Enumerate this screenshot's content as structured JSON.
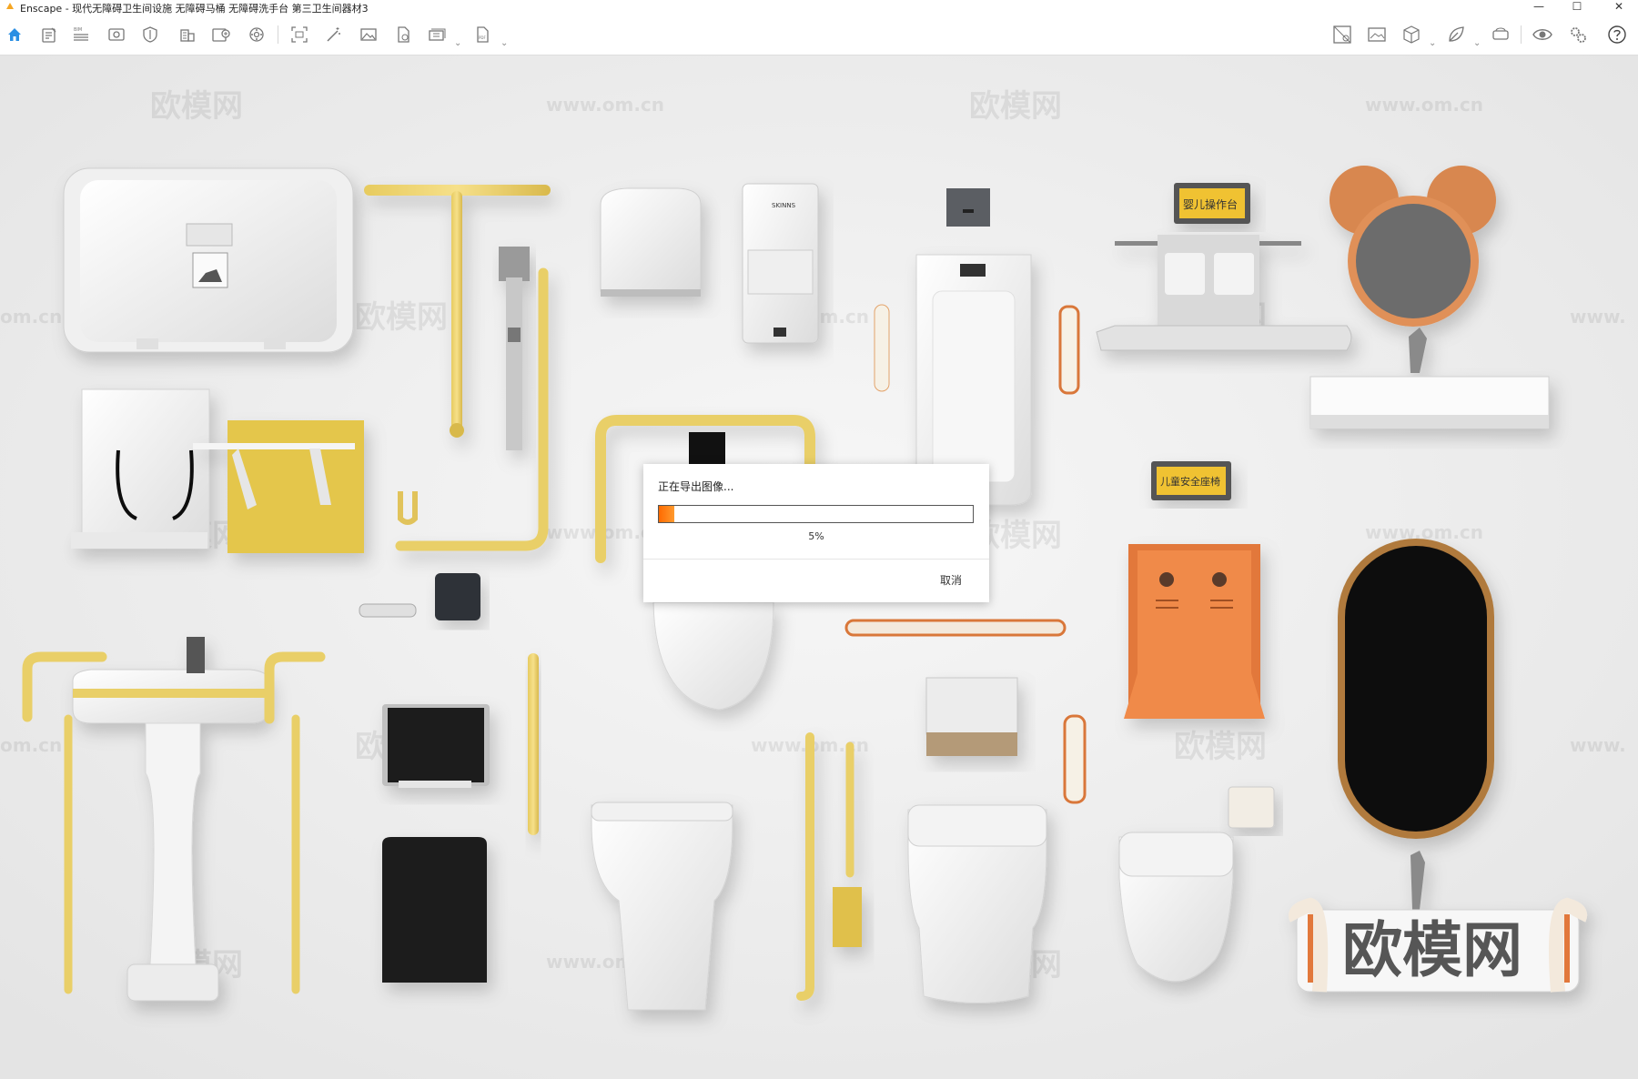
{
  "window": {
    "title": "Enscape - 现代无障碍卫生间设施 无障碍马桶 无障碍洗手台 第三卫生间器材3",
    "minimize": "—",
    "maximize": "☐",
    "close": "✕"
  },
  "toolbar": {
    "left_icons": [
      "home-icon",
      "notes-icon",
      "bim-icon",
      "view-icon",
      "shield-icon",
      "building-icon",
      "add-icon",
      "settings-wheel-icon",
      "capture-icon",
      "magic-icon",
      "image-icon",
      "export-file-icon",
      "batch-render-icon",
      "panorama-export-icon"
    ],
    "right_icons": [
      "asset-library-icon",
      "screenshot-icon",
      "cube-icon",
      "leaf-icon",
      "vr-headset-icon",
      "eye-icon",
      "gears-icon",
      "help-icon"
    ],
    "bim_label": "BIM",
    "pdf_label": "PDF",
    "collapse_arrow": "^"
  },
  "scene": {
    "watermark_cn": "欧模网",
    "watermark_url": "www.om.cn",
    "big_watermark": "欧模网",
    "sign_baby": "婴儿操作台",
    "sign_child": "儿童安全座椅",
    "dryer_brand": "SKINNS",
    "partial_url": "om.cn",
    "partial_url_right": "www."
  },
  "dialog": {
    "title": "正在导出图像...",
    "progress": 5,
    "progress_text": "5%",
    "cancel": "取消"
  }
}
